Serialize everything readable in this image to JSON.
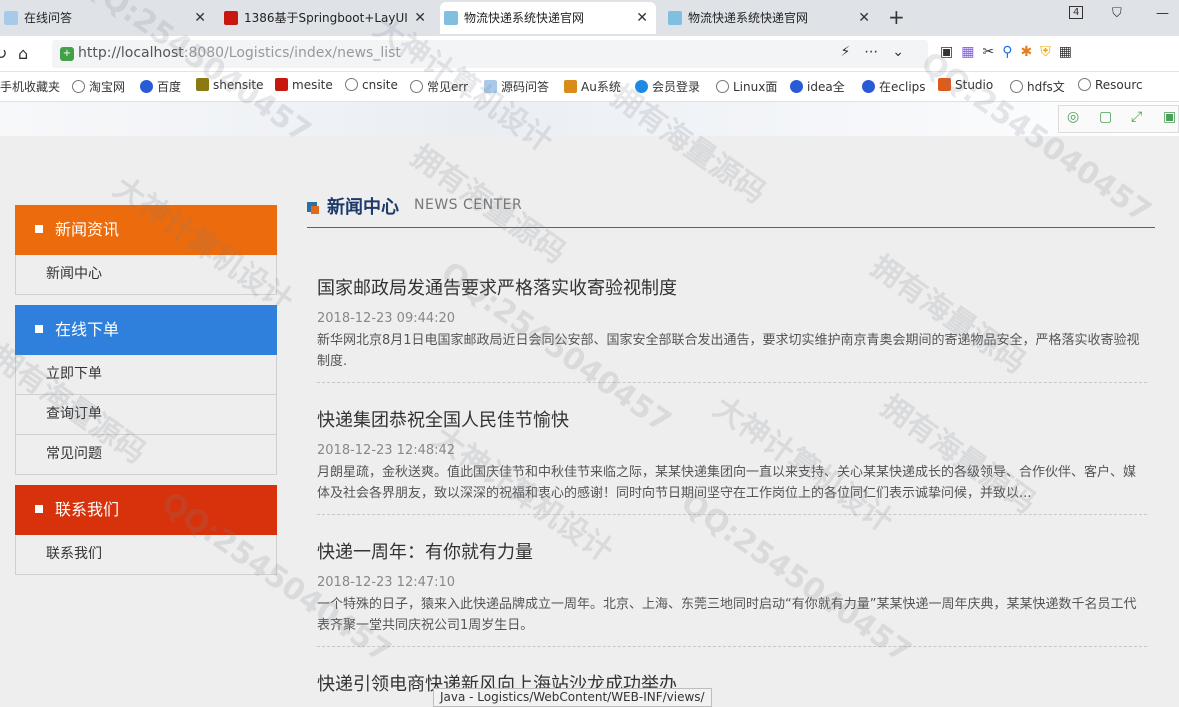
{
  "browser": {
    "tabs": [
      {
        "label": "在线问答",
        "active": false
      },
      {
        "label": "1386基于Springboot+LayUI",
        "active": false
      },
      {
        "label": "物流快递系统快递官网",
        "active": true
      },
      {
        "label": "物流快递系统快递官网",
        "active": false
      }
    ],
    "tab_count_badge": "4",
    "url_host": "http://localhost",
    "url_path": ":8080/Logistics/index/news_list",
    "bookmarks": [
      "手机收藏夹",
      "淘宝网",
      "百度",
      "shensite",
      "mesite",
      "cnsite",
      "常见err",
      "源码问答",
      "Au系统",
      "会员登录",
      "Linux面",
      "idea全",
      "在eclips",
      "Studio",
      "hdfs文",
      "Resourc"
    ],
    "status_text": "Java - Logistics/WebContent/WEB-INF/views/"
  },
  "sidebar": {
    "sections": [
      {
        "title": "新闻资讯",
        "color": "#ec6b0c",
        "items": [
          "新闻中心"
        ]
      },
      {
        "title": "在线下单",
        "color": "#2f7fdc",
        "items": [
          "立即下单",
          "查询订单",
          "常见问题"
        ]
      },
      {
        "title": "联系我们",
        "color": "#d7320c",
        "items": [
          "联系我们"
        ]
      }
    ]
  },
  "main": {
    "title": "新闻中心",
    "subtitle": "NEWS CENTER",
    "news": [
      {
        "title": "国家邮政局发通告要求严格落实收寄验视制度",
        "date": "2018-12-23 09:44:20",
        "summary": "新华网北京8月1日电国家邮政局近日会同公安部、国家安全部联合发出通告，要求切实维护南京青奥会期间的寄递物品安全，严格落实收寄验视制度."
      },
      {
        "title": "快递集团恭祝全国人民佳节愉快",
        "date": "2018-12-23 12:48:42",
        "summary": "月朗星疏，金秋送爽。值此国庆佳节和中秋佳节来临之际，某某快递集团向一直以来支持、关心某某快递成长的各级领导、合作伙伴、客户、媒体及社会各界朋友，致以深深的祝福和衷心的感谢！同时向节日期间坚守在工作岗位上的各位同仁们表示诚挚问候，并致以..."
      },
      {
        "title": "快递一周年：有你就有力量",
        "date": "2018-12-23 12:47:10",
        "summary": "一个特殊的日子，猿来入此快递品牌成立一周年。北京、上海、东莞三地同时启动“有你就有力量”某某快递一周年庆典，某某快递数千名员工代表齐聚一堂共同庆祝公司1周岁生日。"
      },
      {
        "title": "快递引领电商快递新风向上海站沙龙成功举办",
        "date": "",
        "summary": ""
      }
    ]
  },
  "watermarks": [
    "QQ:2545040457",
    "大神计算机设计",
    "拥有海量源码",
    "QQ:2545040457",
    "大神计算机设计",
    "拥有海量源码",
    "QQ:2545040457",
    "大神计算机设计",
    "拥有海量源码",
    "QQ:2545040457",
    "大神计算机设计",
    "拥有海量源码",
    "QQ:2545040457",
    "拥有海量源码"
  ]
}
